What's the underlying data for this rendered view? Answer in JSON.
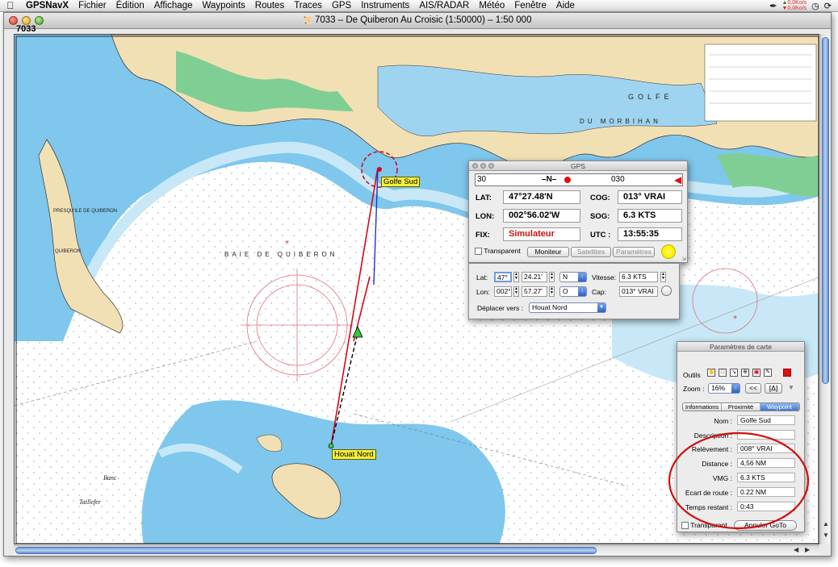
{
  "menubar": {
    "app_name": "GPSNavX",
    "items": [
      "Fichier",
      "Édition",
      "Affichage",
      "Waypoints",
      "Routes",
      "Traces",
      "GPS",
      "Instruments",
      "AIS/RADAR",
      "Météo",
      "Fenêtre",
      "Aide"
    ],
    "net_up": "0,0Ko/s",
    "net_down": "0,0Ko/s"
  },
  "window": {
    "title": "7033 – De Quiberon Au Croisic (1:50000) – 1:50 000",
    "chart_id": "7033"
  },
  "map": {
    "labels": {
      "wp_start": "Golfe Sud",
      "wp_end": "Houat Nord",
      "bay": "BAIE DE QUIBERON",
      "morbihan": "DU MORBIHAN",
      "golfe": "GOLFE",
      "peninsula": "PRESQU'ILE DE QUIBERON",
      "quiberon": "QUIBERON",
      "banc": "Banc",
      "taillefer": "Taillefer"
    },
    "colors": {
      "sea": "#7fc7ec",
      "shallow": "#c8e8f7",
      "land": "#f2e0b5",
      "marsh": "#7fcf95"
    }
  },
  "gps": {
    "title": "GPS",
    "compass": {
      "left": "30",
      "north": "N",
      "right": "030"
    },
    "lat_label": "LAT:",
    "lat": "47°27.48'N",
    "lon_label": "LON:",
    "lon": "002°56.02'W",
    "fix_label": "FIX:",
    "fix": "Simulateur",
    "cog_label": "COG:",
    "cog": "013° VRAI",
    "sog_label": "SOG:",
    "sog": "6.3 KTS",
    "utc_label": "UTC :",
    "utc": "13:55:35",
    "transparent_label": "Transparent",
    "btn_monitor": "Moniteur",
    "btn_satellites": "Satellites",
    "btn_params": "Paramètres"
  },
  "sim": {
    "lat_label": "Lat:",
    "lat_deg": "47°",
    "lat_min": "24.21'",
    "lat_hemi": "N",
    "lon_label": "Lon:",
    "lon_deg": "002°",
    "lon_min": "57.27'",
    "lon_hemi": "O",
    "speed_label": "Vitesse:",
    "speed": "6.3 KTS",
    "cap_label": "Cap:",
    "cap": "013° VRAI",
    "move_label": "Déplacer vers :",
    "move_value": "Houat Nord"
  },
  "params": {
    "title": "Paramètres de carte",
    "tools_label": "Outils",
    "zoom_label": "Zoom :",
    "zoom_value": "16%",
    "btn_back": "<<",
    "btn_delta": "[Δ]",
    "tabs": [
      "Informations",
      "Proximité",
      "Waypoint"
    ],
    "rows": [
      {
        "label": "Nom :",
        "value": "Golfe Sud"
      },
      {
        "label": "Description :",
        "value": ""
      },
      {
        "label": "Relèvement :",
        "value": "008° VRAI"
      },
      {
        "label": "Distance :",
        "value": "4,56 NM"
      },
      {
        "label": "VMG :",
        "value": "6.3 KTS"
      },
      {
        "label": "Ecart de route :",
        "value": "0.22 NM"
      },
      {
        "label": "Temps restant :",
        "value": "0:43"
      }
    ],
    "transparent_label": "Transparent",
    "btn_cancel_goto": "Annuler GoTo"
  }
}
